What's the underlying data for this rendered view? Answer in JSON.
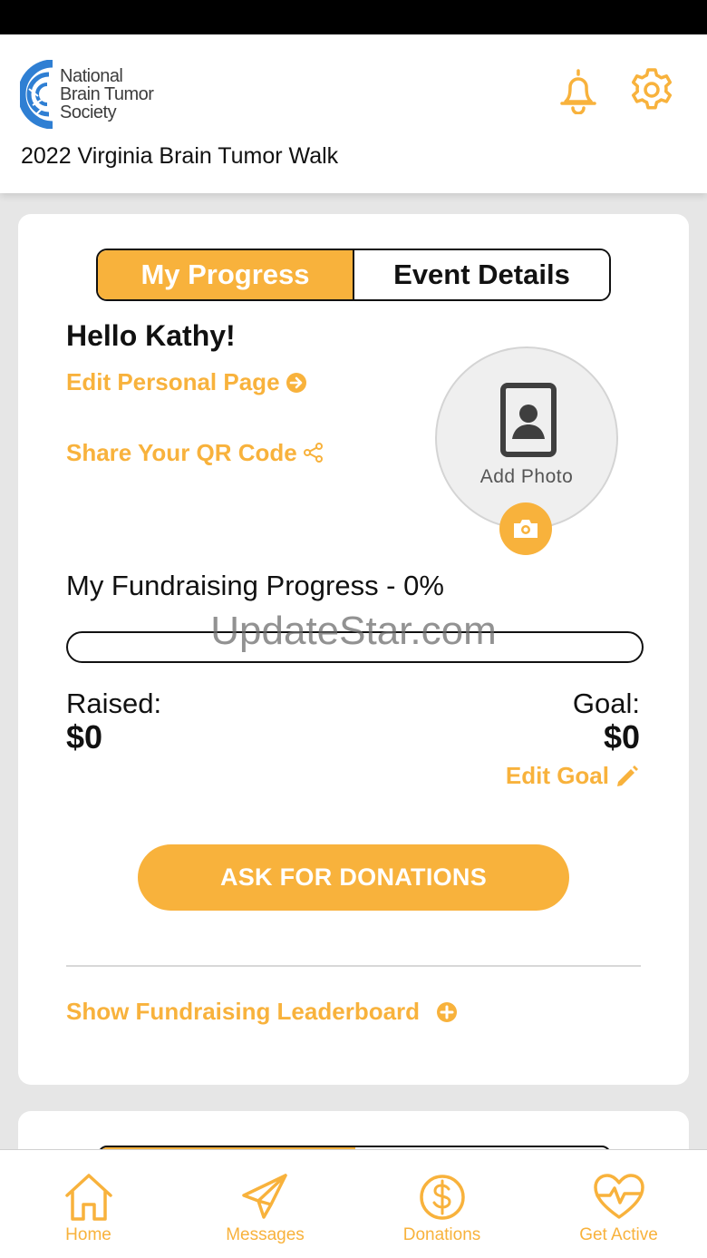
{
  "colors": {
    "accent": "#f8b23c",
    "logo_blue": "#2f7fd3",
    "text": "#111111"
  },
  "header": {
    "logo_lines": [
      "National",
      "Brain Tumor",
      "Society"
    ],
    "event_title": "2022 Virginia Brain Tumor Walk",
    "icons": [
      "bell-icon",
      "gear-icon"
    ]
  },
  "tabs": {
    "active": "My Progress",
    "inactive": "Event Details"
  },
  "greeting": "Hello Kathy!",
  "links": {
    "edit_page": "Edit Personal Page",
    "share_qr": "Share Your QR Code",
    "edit_goal": "Edit Goal",
    "leaderboard": "Show Fundraising Leaderboard"
  },
  "photo": {
    "label": "Add Photo"
  },
  "progress": {
    "title": "My Fundraising Progress - 0%",
    "percent": 0,
    "raised_label": "Raised:",
    "raised_value": "$0",
    "goal_label": "Goal:",
    "goal_value": "$0"
  },
  "watermark": "UpdateStar.com",
  "ask_button": "ASK FOR DONATIONS",
  "nav": {
    "items": [
      {
        "label": "Home",
        "icon": "home-icon"
      },
      {
        "label": "Messages",
        "icon": "paper-plane-icon"
      },
      {
        "label": "Donations",
        "icon": "dollar-circle-icon"
      },
      {
        "label": "Get Active",
        "icon": "heart-pulse-icon"
      }
    ]
  }
}
